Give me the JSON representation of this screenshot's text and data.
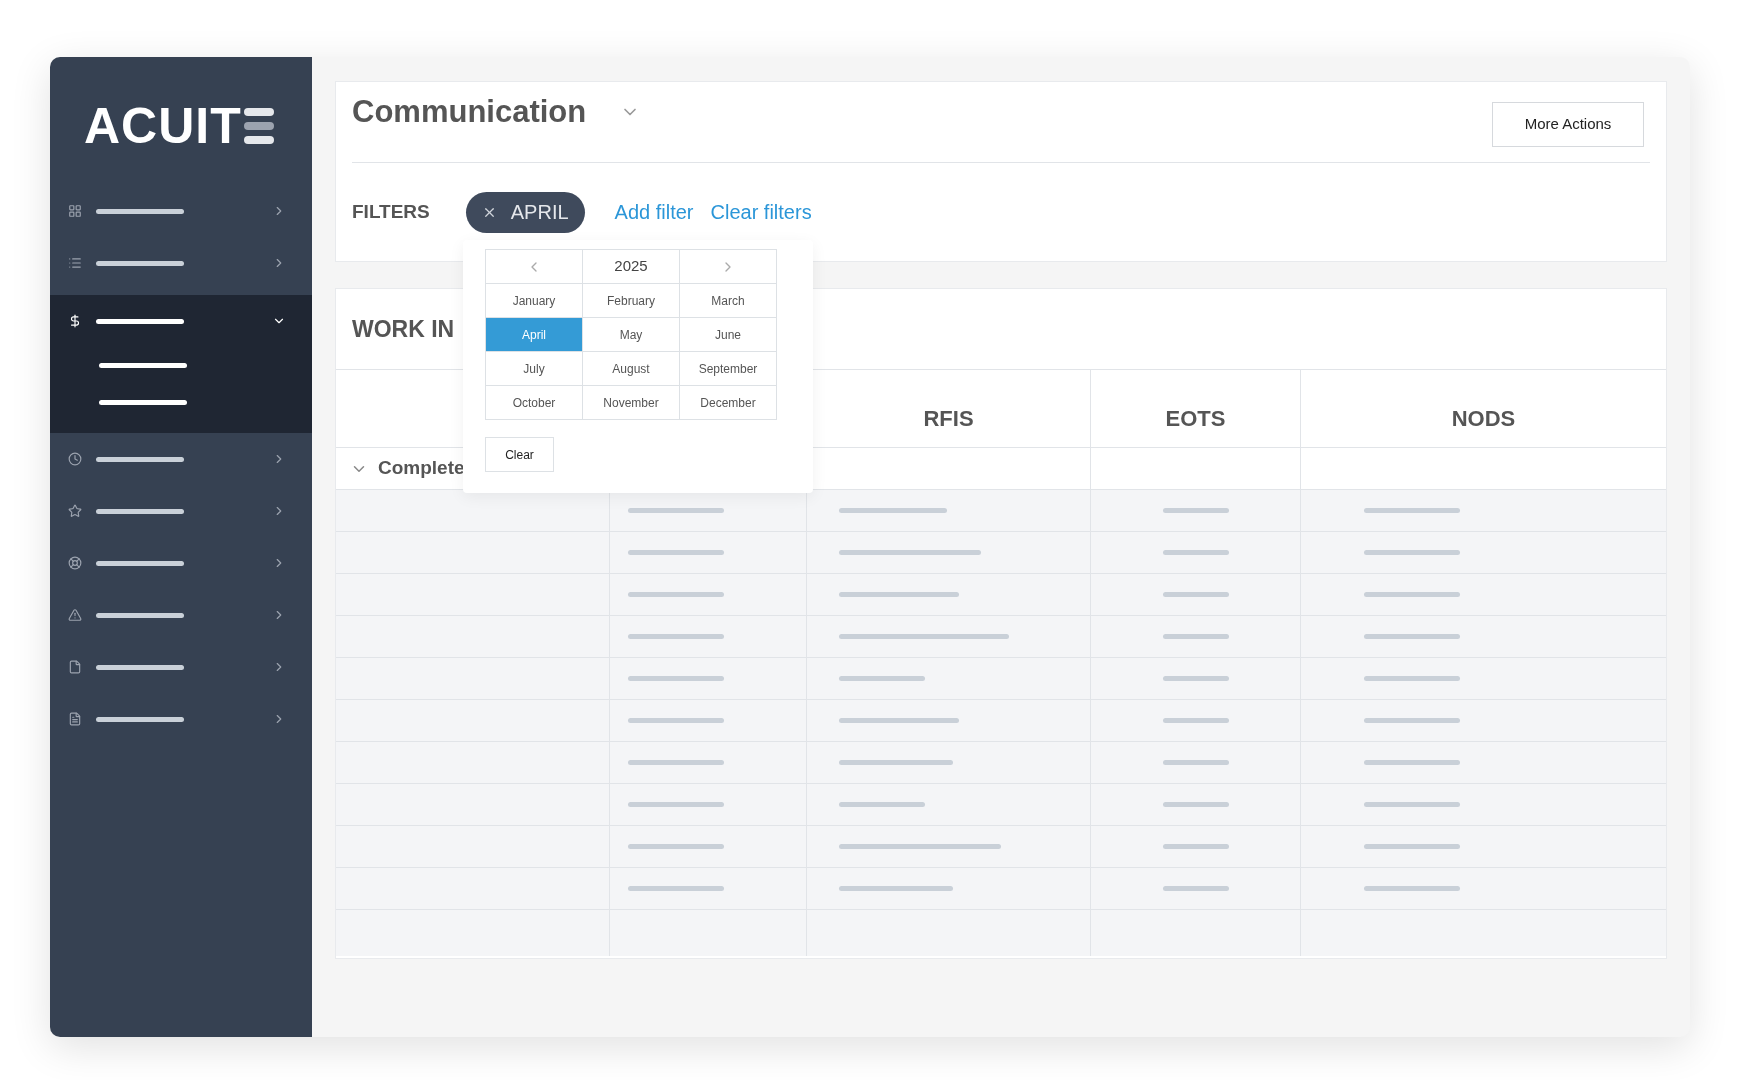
{
  "logo": {
    "text": "ACUIT"
  },
  "sidebar": {
    "items": [
      {
        "selected": false,
        "expanded": false
      },
      {
        "selected": false,
        "expanded": false
      },
      {
        "selected": true,
        "expanded": true,
        "children": [
          {
            "selected": false
          },
          {
            "selected": false
          }
        ]
      },
      {
        "selected": false,
        "expanded": false
      },
      {
        "selected": false,
        "expanded": false
      },
      {
        "selected": false,
        "expanded": false
      },
      {
        "selected": false,
        "expanded": false
      },
      {
        "selected": false,
        "expanded": false
      },
      {
        "selected": false,
        "expanded": false
      }
    ]
  },
  "header": {
    "title": "Communication",
    "more_actions": "More Actions"
  },
  "filters": {
    "label": "FILTERS",
    "chips": [
      {
        "label": "APRIL"
      }
    ],
    "add_filter": "Add filter",
    "clear_filters": "Clear filters"
  },
  "month_picker": {
    "year": "2025",
    "months": [
      {
        "label": "January",
        "selected": false
      },
      {
        "label": "February",
        "selected": false
      },
      {
        "label": "March",
        "selected": false
      },
      {
        "label": "April",
        "selected": true
      },
      {
        "label": "May",
        "selected": false
      },
      {
        "label": "June",
        "selected": false
      },
      {
        "label": "July",
        "selected": false
      },
      {
        "label": "August",
        "selected": false
      },
      {
        "label": "September",
        "selected": false
      },
      {
        "label": "October",
        "selected": false
      },
      {
        "label": "November",
        "selected": false
      },
      {
        "label": "December",
        "selected": false
      }
    ],
    "clear": "Clear"
  },
  "work": {
    "title": "WORK IN",
    "columns": [
      "RFIS",
      "EOTS",
      "NODS"
    ],
    "group": {
      "label": "Complete",
      "expanded": true
    }
  }
}
